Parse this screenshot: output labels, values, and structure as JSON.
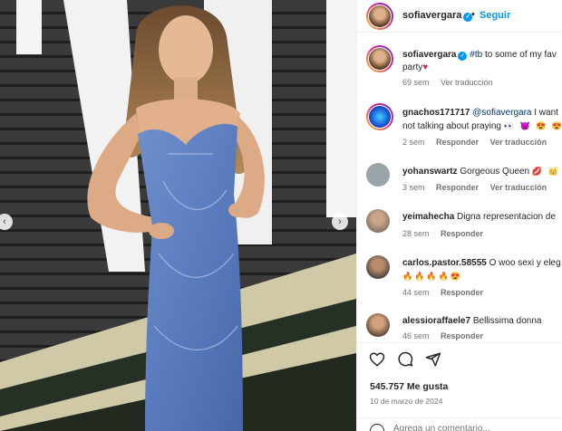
{
  "header": {
    "username": "sofiavergara",
    "dot": "•",
    "follow_label": "Seguir"
  },
  "caption": {
    "username": "sofiavergara",
    "hashtag": "#tb",
    "text": " to some of my fav",
    "line2": "party",
    "emoji": "♥",
    "time": "69 sem",
    "translate": "Ver traducción"
  },
  "comments": [
    {
      "username": "gnachos171717",
      "mention": "@sofiavergara",
      "text": " I want",
      "line2": "not talking about praying",
      "line2_emoji": "👀 😈 😍 😍",
      "time": "2 sem",
      "reply": "Responder",
      "translate": "Ver traducción"
    },
    {
      "username": "yohanswartz",
      "text": " Gorgeous Queen ",
      "emoji": "💋 👑",
      "time": "3 sem",
      "reply": "Responder",
      "translate": "Ver traducción"
    },
    {
      "username": "yeimahecha",
      "text": " Digna representacion de",
      "time": "28 sem",
      "reply": "Responder"
    },
    {
      "username": "carlos.pastor.58555",
      "text": " O woo sexi y eleg",
      "line2_emoji": "🔥🔥🔥🔥😍",
      "time": "44 sem",
      "reply": "Responder"
    },
    {
      "username": "alessioraffaele7",
      "text": " Bellissima donna",
      "time": "46 sem",
      "reply": "Responder"
    }
  ],
  "actions": {
    "likes": "545.757 Me gusta",
    "date": "10 de marzo de 2024",
    "add_comment_placeholder": "Agrega un comentario..."
  },
  "icons": [
    "heart-icon",
    "comment-icon",
    "share-icon",
    "emoji-icon",
    "verified-icon",
    "chevron-left-icon",
    "chevron-right-icon"
  ],
  "colors": {
    "accent": "#0095f6",
    "meta": "#737373",
    "mention": "#00376b"
  }
}
